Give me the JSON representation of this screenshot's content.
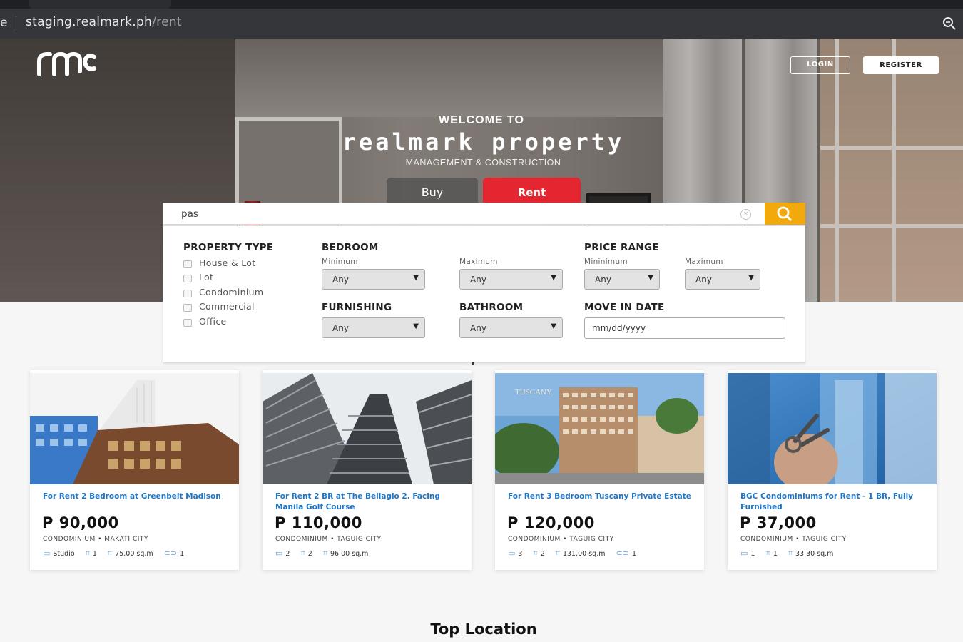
{
  "browser": {
    "edge_char": "e",
    "url_host": "staging.realmark.ph",
    "url_path": "/rent"
  },
  "header": {
    "logo_text": "rmc",
    "login_label": "LOGIN",
    "register_label": "REGISTER"
  },
  "hero": {
    "welcome": "WELCOME TO",
    "brand": "realmark property",
    "tagline": "MANAGEMENT & CONSTRUCTION"
  },
  "tabs": [
    {
      "label": "Buy",
      "active": false
    },
    {
      "label": "Rent",
      "active": true
    }
  ],
  "search": {
    "value": "pas",
    "clear_symbol": "×",
    "button_color": "#f1a90c"
  },
  "filters": {
    "property_type": {
      "heading": "PROPERTY TYPE",
      "options": [
        "House & Lot",
        "Lot",
        "Condominium",
        "Commercial",
        "Office"
      ]
    },
    "bedroom": {
      "heading": "BEDROOM",
      "min_label": "Minimum",
      "max_label": "Maximum",
      "min_value": "Any",
      "max_value": "Any"
    },
    "price_range": {
      "heading": "PRICE RANGE",
      "min_label": "Mininimum",
      "max_label": "Maximum",
      "min_value": "Any",
      "max_value": "Any"
    },
    "furnishing": {
      "heading": "FURNISHING",
      "value": "Any"
    },
    "bathroom": {
      "heading": "BATHROOM",
      "value": "Any"
    },
    "move_in_date": {
      "heading": "MOVE IN DATE",
      "placeholder": "mm/dd/yyyy"
    }
  },
  "listings": [
    {
      "title": "For Rent 2 Bedroom at Greenbelt Madison",
      "price": "P 90,000",
      "location": "CONDOMINIUM • MAKATI CITY",
      "bedrooms": "Studio",
      "bathrooms": "1",
      "area": "75.00 sq.m",
      "parking": "1",
      "photo_theme": "white-blue-tower"
    },
    {
      "title": "For Rent 2 BR at The Bellagio 2. Facing Manila Golf Course",
      "price": "P 110,000",
      "location": "CONDOMINIUM • TAGUIG CITY",
      "bedrooms": "2",
      "bathrooms": "2",
      "area": "96.00 sq.m",
      "parking": "",
      "photo_theme": "twin-towers-lookup"
    },
    {
      "title": "For Rent 3 Bedroom Tuscany Private Estate",
      "price": "P 120,000",
      "location": "CONDOMINIUM • TAGUIG CITY",
      "bedrooms": "3",
      "bathrooms": "2",
      "area": "131.00 sq.m",
      "parking": "1",
      "photo_theme": "tuscany-building",
      "photo_caption": "TUSCANY"
    },
    {
      "title": "BGC Condominiums for Rent - 1 BR, Fully Furnished",
      "price": "P 37,000",
      "location": "CONDOMINIUM • TAGUIG CITY",
      "bedrooms": "1",
      "bathrooms": "1",
      "area": "33.30 sq.m",
      "parking": "",
      "photo_theme": "keys-and-glass-towers"
    }
  ],
  "sections": {
    "top_location": "Top Location"
  },
  "colors": {
    "accent_red": "#e3262f",
    "search_orange": "#f1a90c",
    "listing_title_blue": "#1d76c8"
  }
}
